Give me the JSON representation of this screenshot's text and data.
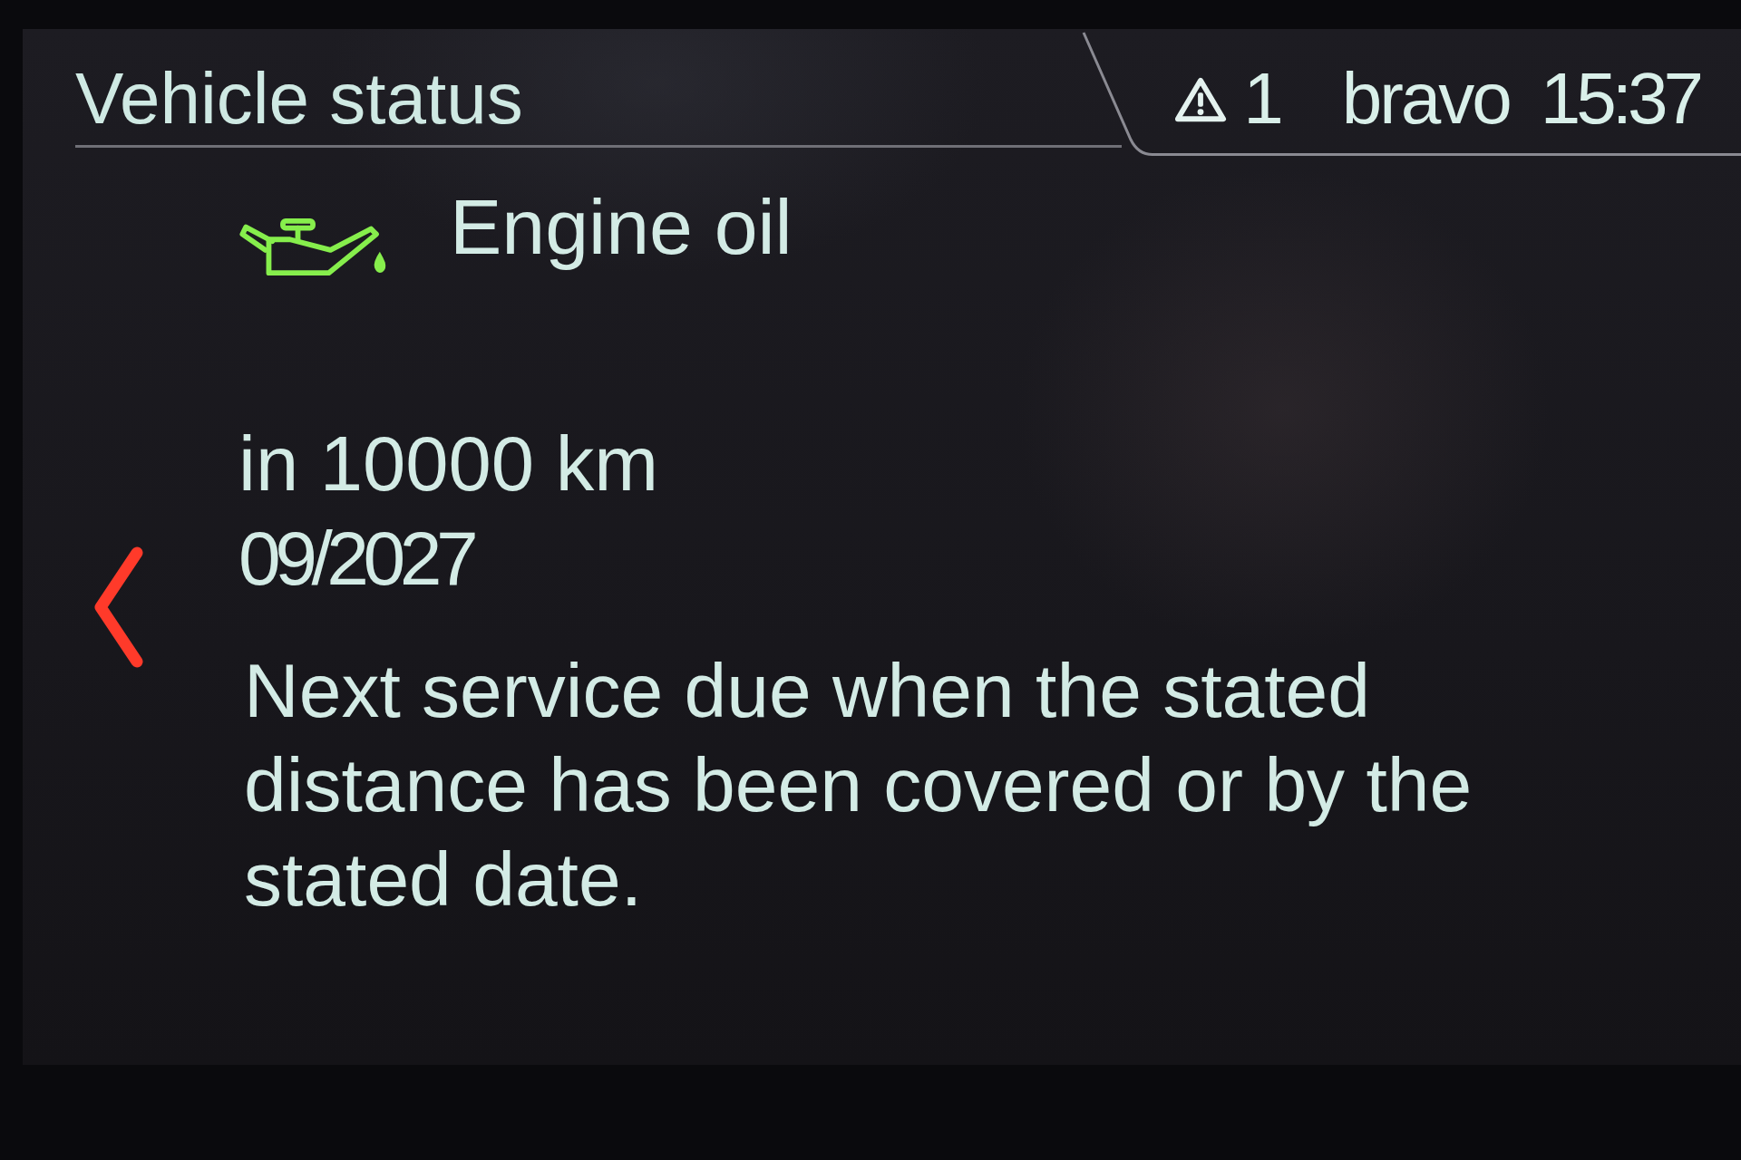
{
  "header": {
    "title": "Vehicle status",
    "status": {
      "warning_count": "1",
      "profile": "bravo",
      "time": "15:37"
    }
  },
  "service_item": {
    "title": "Engine oil",
    "distance": "in 10000 km",
    "date": "09/2027",
    "description": "Next service due when the stated distance has been covered or by the stated date."
  }
}
